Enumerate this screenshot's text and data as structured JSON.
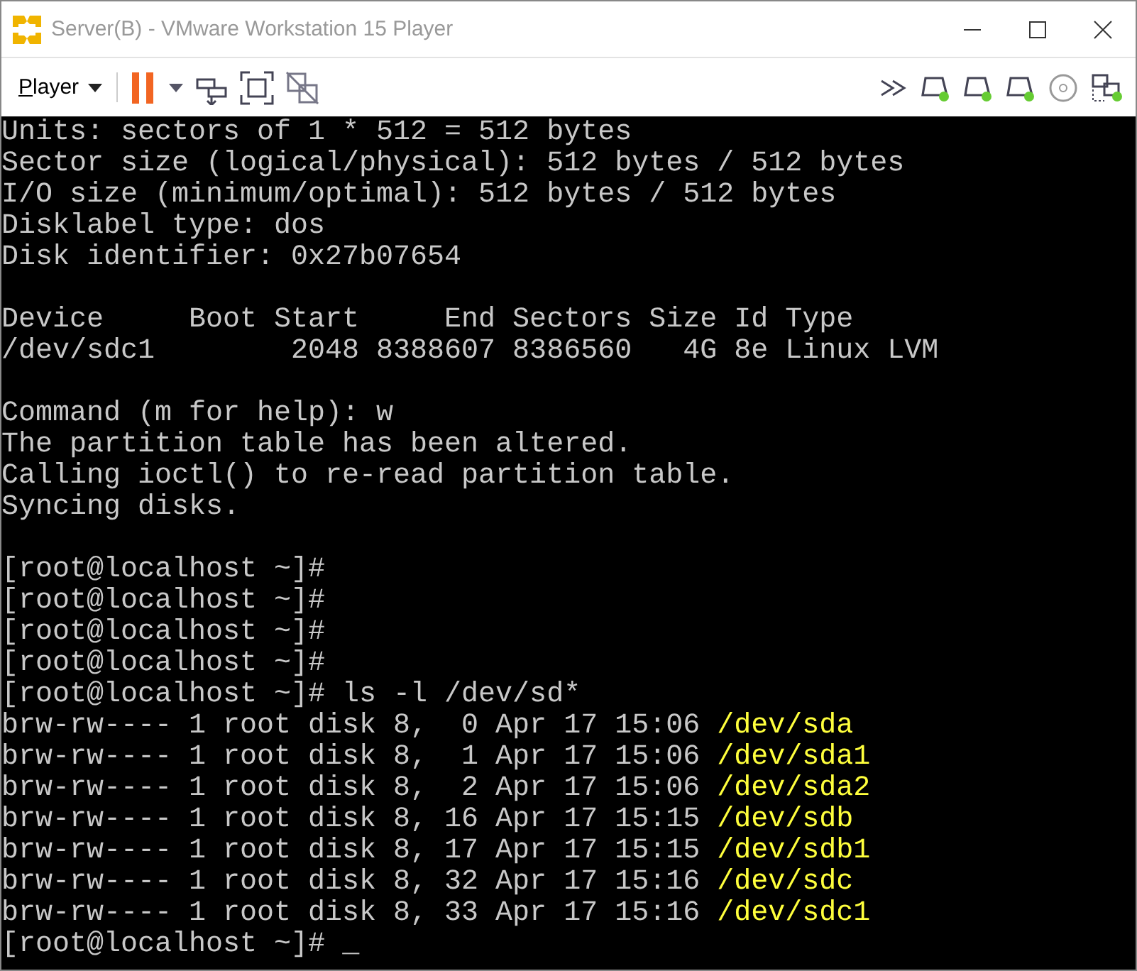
{
  "window": {
    "title": "Server(B) - VMware Workstation 15 Player"
  },
  "toolbar": {
    "menu": {
      "label": "Player"
    }
  },
  "terminal": {
    "lines": [
      {
        "kind": "text",
        "text": "Units: sectors of 1 * 512 = 512 bytes"
      },
      {
        "kind": "text",
        "text": "Sector size (logical/physical): 512 bytes / 512 bytes"
      },
      {
        "kind": "text",
        "text": "I/O size (minimum/optimal): 512 bytes / 512 bytes"
      },
      {
        "kind": "text",
        "text": "Disklabel type: dos"
      },
      {
        "kind": "text",
        "text": "Disk identifier: 0x27b07654"
      },
      {
        "kind": "blank"
      },
      {
        "kind": "text",
        "text": "Device     Boot Start     End Sectors Size Id Type"
      },
      {
        "kind": "text",
        "text": "/dev/sdc1        2048 8388607 8386560   4G 8e Linux LVM"
      },
      {
        "kind": "blank"
      },
      {
        "kind": "text",
        "text": "Command (m for help): w"
      },
      {
        "kind": "text",
        "text": "The partition table has been altered."
      },
      {
        "kind": "text",
        "text": "Calling ioctl() to re-read partition table."
      },
      {
        "kind": "text",
        "text": "Syncing disks."
      },
      {
        "kind": "blank"
      },
      {
        "kind": "text",
        "text": "[root@localhost ~]#"
      },
      {
        "kind": "text",
        "text": "[root@localhost ~]#"
      },
      {
        "kind": "text",
        "text": "[root@localhost ~]#"
      },
      {
        "kind": "text",
        "text": "[root@localhost ~]#"
      },
      {
        "kind": "text",
        "text": "[root@localhost ~]# ls -l /dev/sd*"
      },
      {
        "kind": "file",
        "text": "brw-rw---- 1 root disk 8,  0 Apr 17 15:06",
        "file": "/dev/sda"
      },
      {
        "kind": "file",
        "text": "brw-rw---- 1 root disk 8,  1 Apr 17 15:06",
        "file": "/dev/sda1"
      },
      {
        "kind": "file",
        "text": "brw-rw---- 1 root disk 8,  2 Apr 17 15:06",
        "file": "/dev/sda2"
      },
      {
        "kind": "file",
        "text": "brw-rw---- 1 root disk 8, 16 Apr 17 15:15",
        "file": "/dev/sdb"
      },
      {
        "kind": "file",
        "text": "brw-rw---- 1 root disk 8, 17 Apr 17 15:15",
        "file": "/dev/sdb1"
      },
      {
        "kind": "file",
        "text": "brw-rw---- 1 root disk 8, 32 Apr 17 15:16",
        "file": "/dev/sdc"
      },
      {
        "kind": "file",
        "text": "brw-rw---- 1 root disk 8, 33 Apr 17 15:16",
        "file": "/dev/sdc1"
      },
      {
        "kind": "prompt",
        "text": "[root@localhost ~]#",
        "cursor": "_"
      }
    ]
  }
}
